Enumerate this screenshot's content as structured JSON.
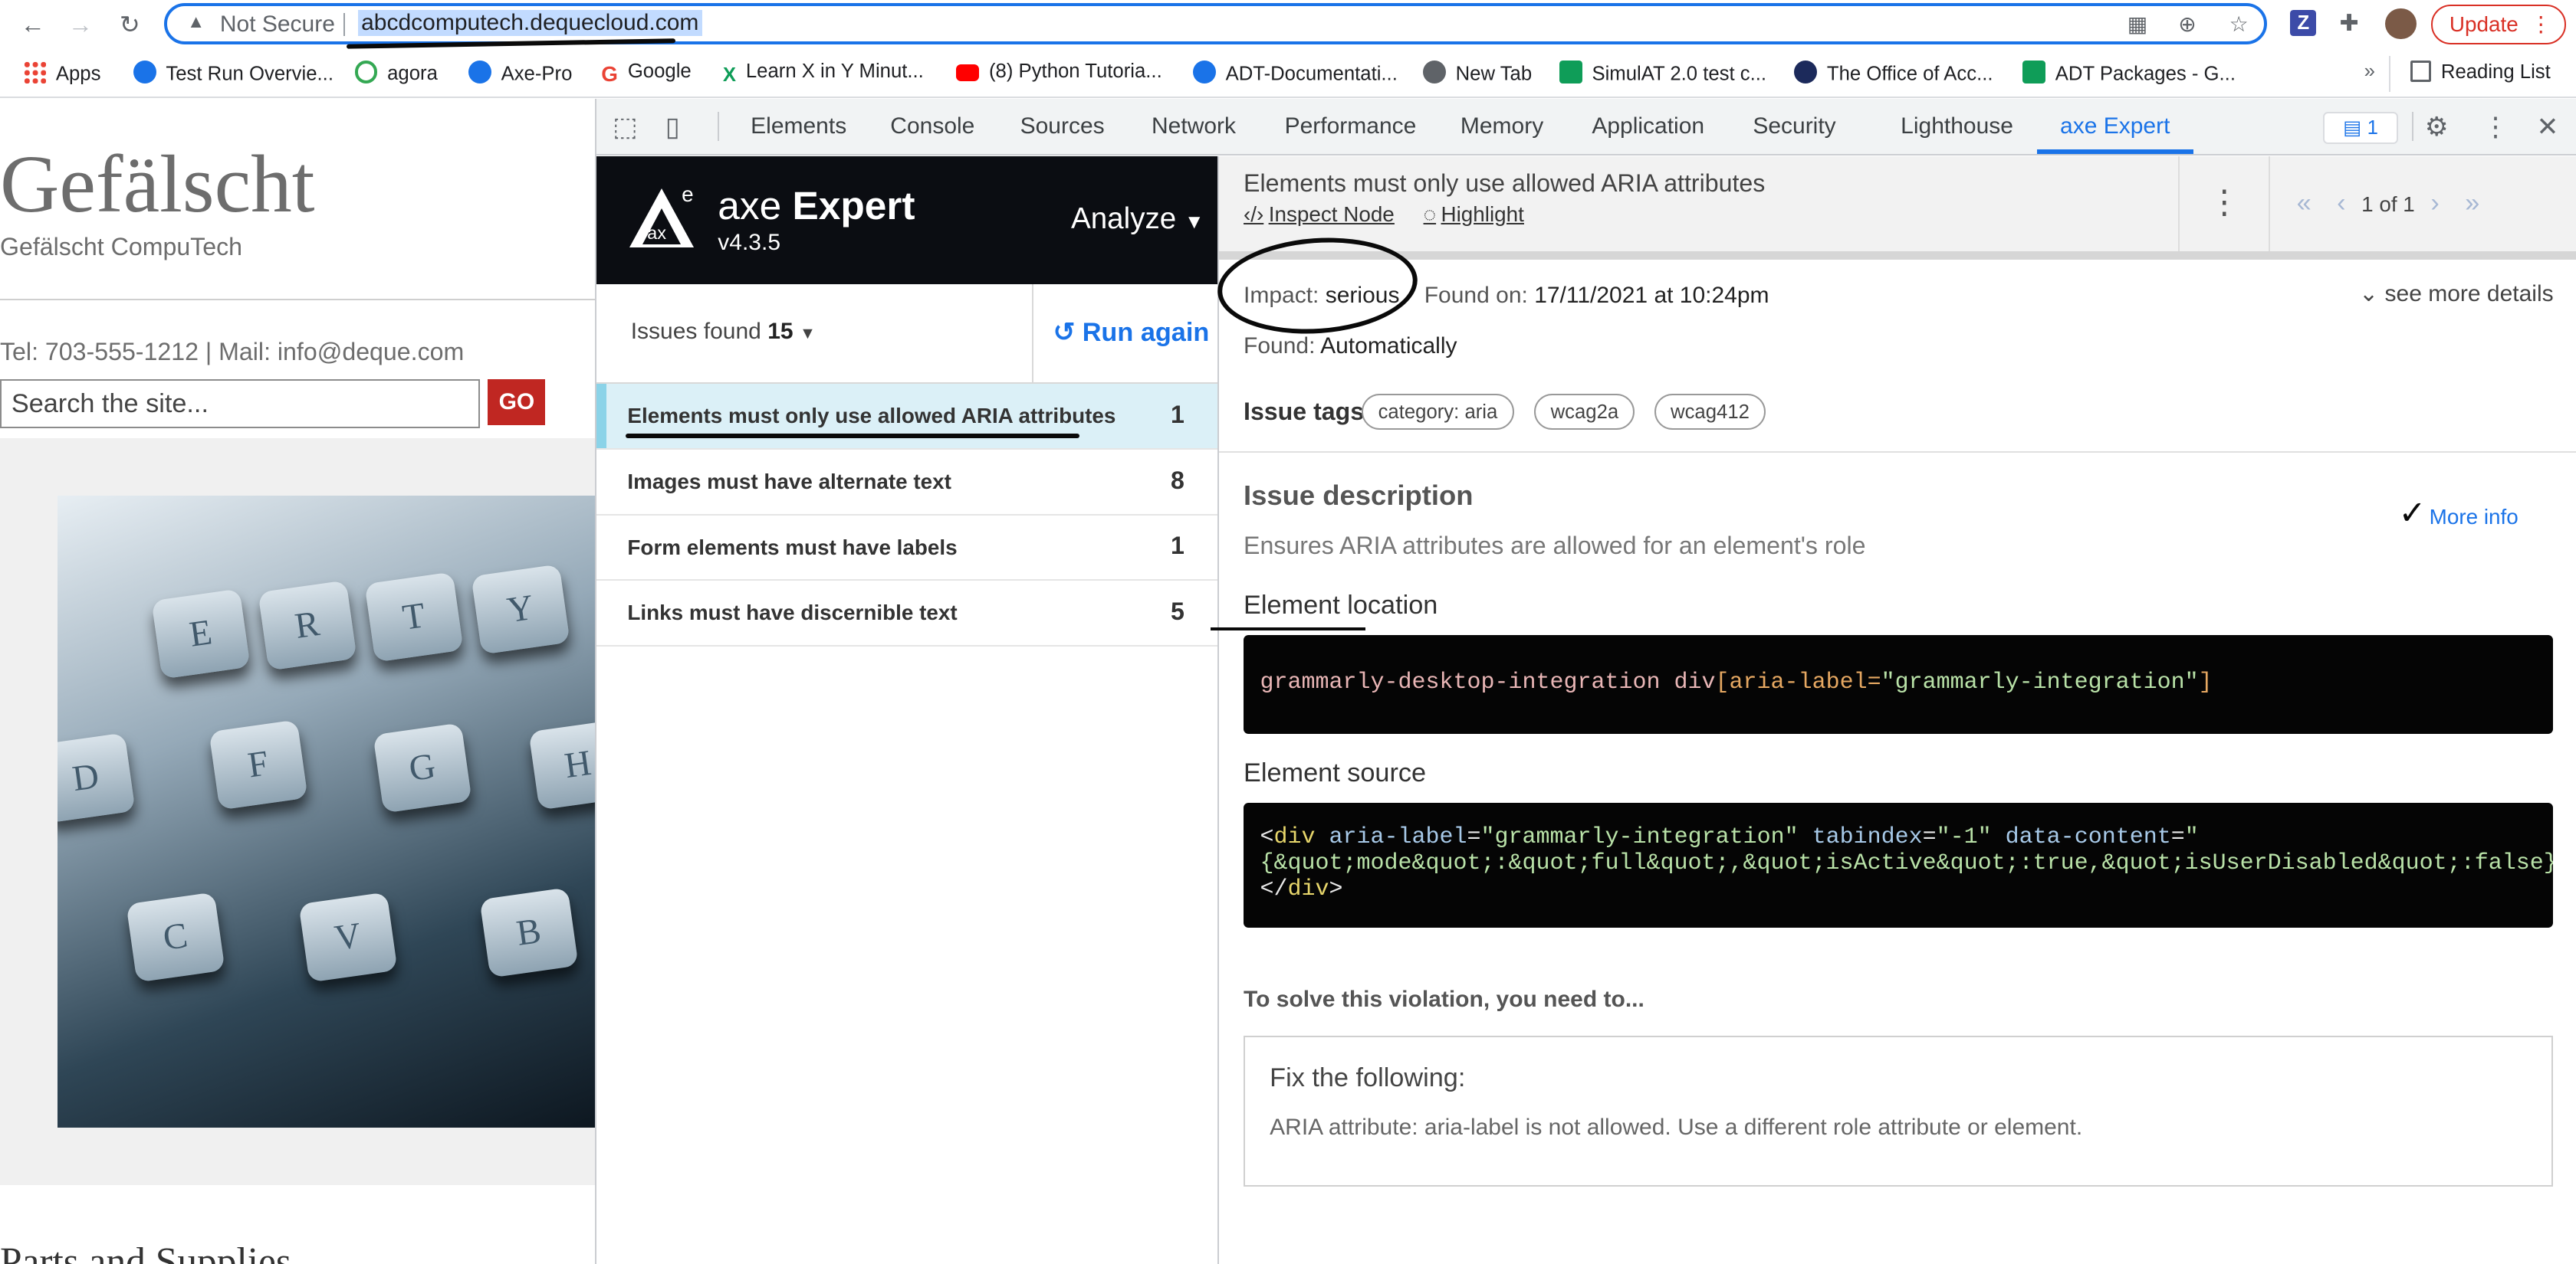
{
  "browser": {
    "security_label": "Not Secure",
    "url": "abcdcomputech.dequecloud.com",
    "update_label": "Update",
    "bookmarks": [
      {
        "label": "Apps"
      },
      {
        "label": "Test Run Overvie..."
      },
      {
        "label": "agora"
      },
      {
        "label": "Axe-Pro"
      },
      {
        "label": "Google"
      },
      {
        "label": "Learn X in Y Minut..."
      },
      {
        "label": "(8) Python Tutoria..."
      },
      {
        "label": "ADT-Documentati..."
      },
      {
        "label": "New Tab"
      },
      {
        "label": "SimulAT 2.0 test c..."
      },
      {
        "label": "The Office of Acc..."
      },
      {
        "label": "ADT Packages - G..."
      }
    ],
    "more_bookmarks": "»",
    "reading_list": "Reading List"
  },
  "site": {
    "title": "Gefälscht",
    "subtitle": "Gefälscht CompuTech",
    "contact": "Tel: 703-555-1212 | Mail: info@deque.com",
    "search_placeholder": "Search the site...",
    "go_label": "GO",
    "keys": [
      "E",
      "R",
      "T",
      "Y",
      "D",
      "F",
      "G",
      "H",
      "C",
      "V",
      "B"
    ],
    "section_title": "Parts and Supplies"
  },
  "devtools": {
    "tabs": [
      "Elements",
      "Console",
      "Sources",
      "Network",
      "Performance",
      "Memory",
      "Application",
      "Security",
      "Lighthouse",
      "axe Expert"
    ],
    "active_tab": "axe Expert",
    "message_count": "1"
  },
  "axe": {
    "logo_letter": "e",
    "logo_text": "ax",
    "title_light": "axe",
    "title_bold": "Expert",
    "version": "v4.3.5",
    "analyze_label": "Analyze",
    "issues_found_label": "Issues found",
    "issues_found_count": "15",
    "run_again_label": "Run again",
    "issues": [
      {
        "label": "Elements must only use allowed ARIA attributes",
        "count": "1"
      },
      {
        "label": "Images must have alternate text",
        "count": "8"
      },
      {
        "label": "Form elements must have labels",
        "count": "1"
      },
      {
        "label": "Links must have discernible text",
        "count": "5"
      }
    ]
  },
  "detail": {
    "title": "Elements must only use allowed ARIA attributes",
    "inspect_label": "Inspect Node",
    "highlight_label": "Highlight",
    "pager": "1 of 1",
    "impact_label": "Impact:",
    "impact_value": "serious",
    "found_on_label": "Found on:",
    "found_on_value": "17/11/2021 at 10:24pm",
    "see_more": "see more details",
    "found_label": "Found:",
    "found_value": "Automatically",
    "tags_label": "Issue tags",
    "tags": [
      "category: aria",
      "wcag2a",
      "wcag412"
    ],
    "description_heading": "Issue description",
    "more_info": "More info",
    "description": "Ensures ARIA attributes are allowed for an element's role",
    "location_heading": "Element location",
    "location_selector": "grammarly-desktop-integration div",
    "location_attr": "[aria-label=",
    "location_value": "\"grammarly-integration\"",
    "location_close": "]",
    "source_heading": "Element source",
    "source_line1_open": "<",
    "source_line1_tag": "div",
    "source_line1_attr1": " aria-label",
    "source_line1_eq1": "=",
    "source_line1_val1": "\"grammarly-integration\"",
    "source_line1_attr2": " tabindex",
    "source_line1_eq2": "=",
    "source_line1_val2": "\"-1\"",
    "source_line1_attr3": " data-content",
    "source_line1_eq3": "=",
    "source_line1_val3": "\"",
    "source_line2": "{&quot;mode&quot;:&quot;full&quot;,&quot;isActive&quot;:true,&quot;isUserDisabled&quot;:false}\"",
    "source_line3_open": "</",
    "source_line3_tag": "div",
    "source_line3_close": ">",
    "solve_heading": "To solve this violation, you need to...",
    "fix_heading": "Fix the following:",
    "fix_text": "ARIA attribute: aria-label is not allowed. Use a different role attribute or element."
  }
}
